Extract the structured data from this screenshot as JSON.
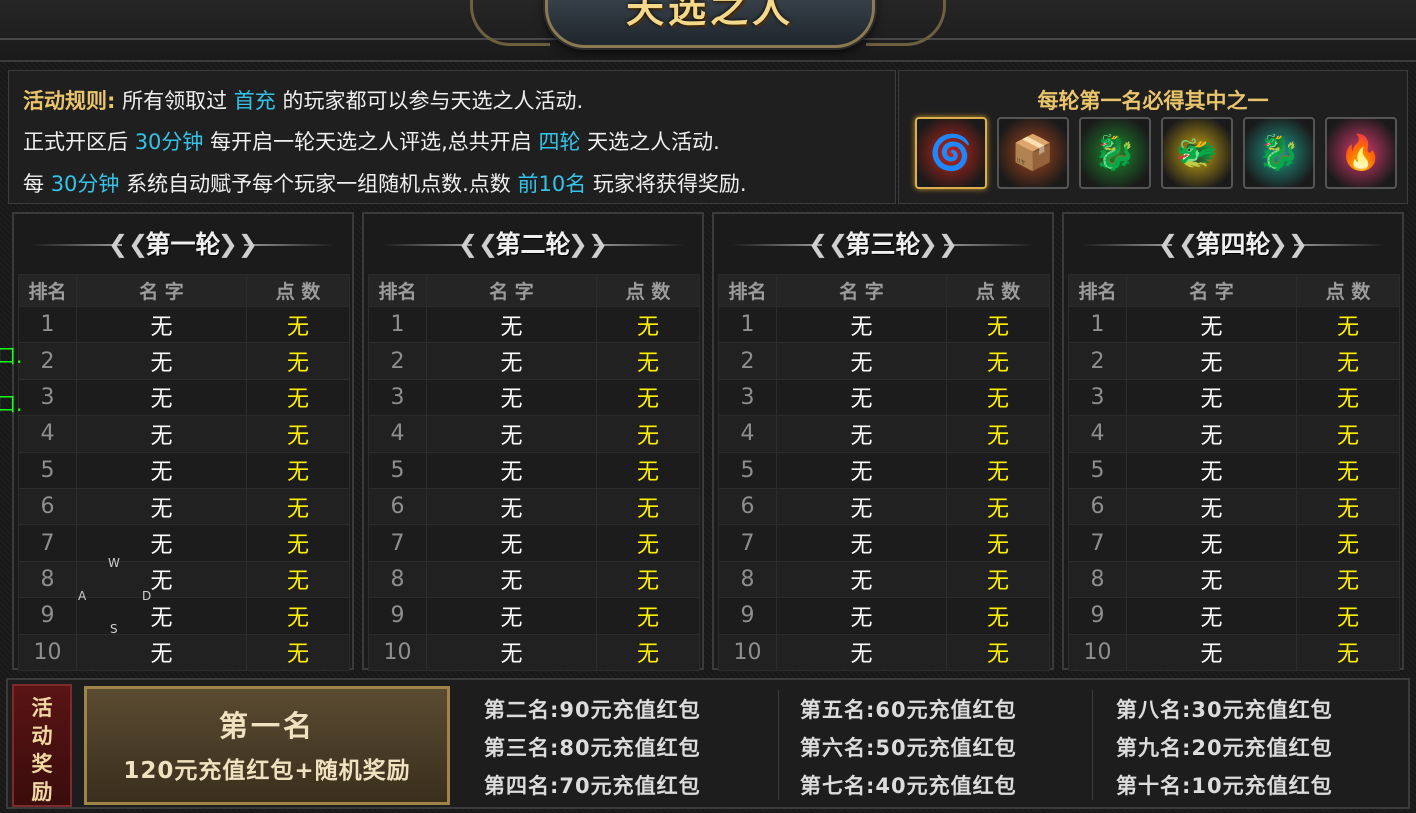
{
  "title": "天选之人",
  "rules": {
    "label": "活动规则:",
    "line1_a": "所有领取过",
    "line1_hl": "首充",
    "line1_b": "的玩家都可以参与天选之人活动.",
    "line2_a": "正式开区后",
    "line2_hl1": "30分钟",
    "line2_b": "每开启一轮天选之人评选,总共开启",
    "line2_hl2": "四轮",
    "line2_c": "天选之人活动.",
    "line3_a": "每",
    "line3_hl1": "30分钟",
    "line3_b": "系统自动赋予每个玩家一组随机点数.点数",
    "line3_hl2": "前10名",
    "line3_c": "玩家将获得奖励."
  },
  "prize_header": "每轮第一名必得其中之一",
  "prize_items": [
    {
      "icon": "red-swirl-orb-icon",
      "glyph": "🌀",
      "color": "#c0261a",
      "selected": true
    },
    {
      "icon": "flame-box-icon",
      "glyph": "📦",
      "color": "#a3451c",
      "selected": false
    },
    {
      "icon": "green-dragon-icon",
      "glyph": "🐉",
      "color": "#1d8a2c",
      "selected": false
    },
    {
      "icon": "gold-dragon-icon",
      "glyph": "🐲",
      "color": "#c9a512",
      "selected": false
    },
    {
      "icon": "teal-dragon-icon",
      "glyph": "🐉",
      "color": "#1e9a8a",
      "selected": false
    },
    {
      "icon": "pink-flame-icon",
      "glyph": "🔥",
      "color": "#d63a6e",
      "selected": false
    }
  ],
  "table_headers": {
    "rank": "排名",
    "name": "名 字",
    "points": "点 数"
  },
  "rounds": [
    {
      "title": "第一轮",
      "rows": [
        {
          "rank": "1",
          "name": "无",
          "points": "无"
        },
        {
          "rank": "2",
          "name": "无",
          "points": "无"
        },
        {
          "rank": "3",
          "name": "无",
          "points": "无"
        },
        {
          "rank": "4",
          "name": "无",
          "points": "无"
        },
        {
          "rank": "5",
          "name": "无",
          "points": "无"
        },
        {
          "rank": "6",
          "name": "无",
          "points": "无"
        },
        {
          "rank": "7",
          "name": "无",
          "points": "无"
        },
        {
          "rank": "8",
          "name": "无",
          "points": "无"
        },
        {
          "rank": "9",
          "name": "无",
          "points": "无"
        },
        {
          "rank": "10",
          "name": "无",
          "points": "无"
        }
      ]
    },
    {
      "title": "第二轮",
      "rows": [
        {
          "rank": "1",
          "name": "无",
          "points": "无"
        },
        {
          "rank": "2",
          "name": "无",
          "points": "无"
        },
        {
          "rank": "3",
          "name": "无",
          "points": "无"
        },
        {
          "rank": "4",
          "name": "无",
          "points": "无"
        },
        {
          "rank": "5",
          "name": "无",
          "points": "无"
        },
        {
          "rank": "6",
          "name": "无",
          "points": "无"
        },
        {
          "rank": "7",
          "name": "无",
          "points": "无"
        },
        {
          "rank": "8",
          "name": "无",
          "points": "无"
        },
        {
          "rank": "9",
          "name": "无",
          "points": "无"
        },
        {
          "rank": "10",
          "name": "无",
          "points": "无"
        }
      ]
    },
    {
      "title": "第三轮",
      "rows": [
        {
          "rank": "1",
          "name": "无",
          "points": "无"
        },
        {
          "rank": "2",
          "name": "无",
          "points": "无"
        },
        {
          "rank": "3",
          "name": "无",
          "points": "无"
        },
        {
          "rank": "4",
          "name": "无",
          "points": "无"
        },
        {
          "rank": "5",
          "name": "无",
          "points": "无"
        },
        {
          "rank": "6",
          "name": "无",
          "points": "无"
        },
        {
          "rank": "7",
          "name": "无",
          "points": "无"
        },
        {
          "rank": "8",
          "name": "无",
          "points": "无"
        },
        {
          "rank": "9",
          "name": "无",
          "points": "无"
        },
        {
          "rank": "10",
          "name": "无",
          "points": "无"
        }
      ]
    },
    {
      "title": "第四轮",
      "rows": [
        {
          "rank": "1",
          "name": "无",
          "points": "无"
        },
        {
          "rank": "2",
          "name": "无",
          "points": "无"
        },
        {
          "rank": "3",
          "name": "无",
          "points": "无"
        },
        {
          "rank": "4",
          "name": "无",
          "points": "无"
        },
        {
          "rank": "5",
          "name": "无",
          "points": "无"
        },
        {
          "rank": "6",
          "name": "无",
          "points": "无"
        },
        {
          "rank": "7",
          "name": "无",
          "points": "无"
        },
        {
          "rank": "8",
          "name": "无",
          "points": "无"
        },
        {
          "rank": "9",
          "name": "无",
          "points": "无"
        },
        {
          "rank": "10",
          "name": "无",
          "points": "无"
        }
      ]
    }
  ],
  "rewards": {
    "tag": [
      "活",
      "动",
      "奖",
      "励"
    ],
    "first_title": "第一名",
    "first_prize": "120元充值红包+随机奖励",
    "list": [
      "第二名:90元充值红包",
      "第三名:80元充值红包",
      "第四名:70元充值红包",
      "第五名:60元充值红包",
      "第六名:50元充值红包",
      "第七名:40元充值红包",
      "第八名:30元充值红包",
      "第九名:20元充值红包",
      "第十名:10元充值红包"
    ]
  },
  "hud": {
    "w": "W",
    "a": "A",
    "s": "S",
    "d": "D",
    "green_marks": [
      "口.",
      "口."
    ]
  }
}
